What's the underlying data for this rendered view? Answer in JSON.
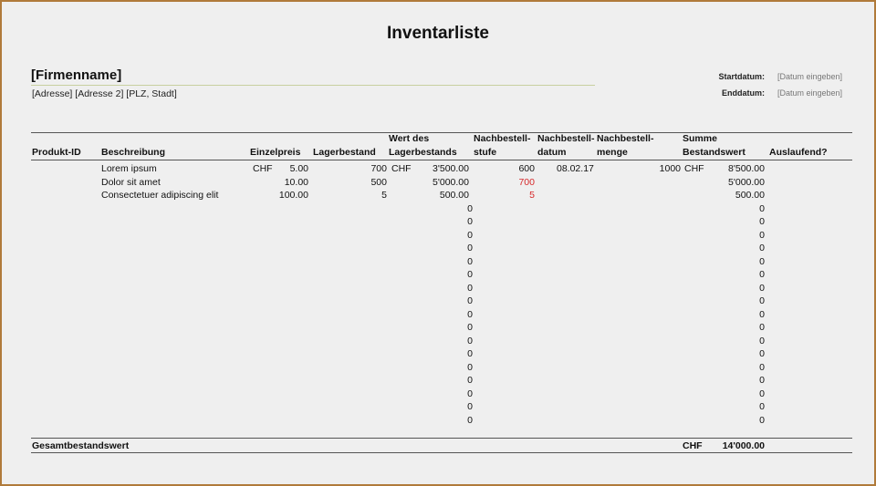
{
  "title": "Inventarliste",
  "company": {
    "name": "[Firmenname]",
    "address": "[Adresse] [Adresse 2] [PLZ, Stadt]"
  },
  "dates": {
    "start_label": "Startdatum:",
    "start_value": "[Datum eingeben]",
    "end_label": "Enddatum:",
    "end_value": "[Datum eingeben]"
  },
  "table": {
    "headers": {
      "product_id": "Produkt-ID",
      "description": "Beschreibung",
      "unit_price": "Einzelpreis",
      "stock": "Lagerbestand",
      "stock_value": "Wert des\nLagerbestands",
      "reorder_level": "Nachbestell-\nstufe",
      "reorder_date": "Nachbestell-\ndatum",
      "reorder_qty": "Nachbestell-\nmenge",
      "total_stock_value": "Summe\nBestandswert",
      "discontinued": "Auslaufend?"
    },
    "rows": [
      {
        "product_id": "",
        "description": "Lorem ipsum",
        "price_currency": "CHF",
        "price": "5.00",
        "stock": "700",
        "value_currency": "CHF",
        "value": "3'500.00",
        "reorder_level": "600",
        "reorder_level_highlight": false,
        "reorder_date": "08.02.17",
        "reorder_qty": "1000",
        "total_currency": "CHF",
        "total": "8'500.00",
        "discontinued": ""
      },
      {
        "product_id": "",
        "description": "Dolor sit amet",
        "price_currency": "",
        "price": "10.00",
        "stock": "500",
        "value_currency": "",
        "value": "5'000.00",
        "reorder_level": "700",
        "reorder_level_highlight": true,
        "reorder_date": "",
        "reorder_qty": "",
        "total_currency": "",
        "total": "5'000.00",
        "discontinued": ""
      },
      {
        "product_id": "",
        "description": "Consectetuer adipiscing elit",
        "price_currency": "",
        "price": "100.00",
        "stock": "5",
        "value_currency": "",
        "value": "500.00",
        "reorder_level": "5",
        "reorder_level_highlight": true,
        "reorder_date": "",
        "reorder_qty": "",
        "total_currency": "",
        "total": "500.00",
        "discontinued": ""
      }
    ],
    "empty_rows": [
      {
        "value": "0",
        "total": "0"
      },
      {
        "value": "0",
        "total": "0"
      },
      {
        "value": "0",
        "total": "0"
      },
      {
        "value": "0",
        "total": "0"
      },
      {
        "value": "0",
        "total": "0"
      },
      {
        "value": "0",
        "total": "0"
      },
      {
        "value": "0",
        "total": "0"
      },
      {
        "value": "0",
        "total": "0"
      },
      {
        "value": "0",
        "total": "0"
      },
      {
        "value": "0",
        "total": "0"
      },
      {
        "value": "0",
        "total": "0"
      },
      {
        "value": "0",
        "total": "0"
      },
      {
        "value": "0",
        "total": "0"
      },
      {
        "value": "0",
        "total": "0"
      },
      {
        "value": "0",
        "total": "0"
      },
      {
        "value": "0",
        "total": "0"
      },
      {
        "value": "0",
        "total": "0"
      }
    ],
    "footer": {
      "label": "Gesamtbestandswert",
      "currency": "CHF",
      "total": "14'000.00"
    }
  },
  "colors": {
    "frame_border": "#b07a3a",
    "background": "#efefef",
    "highlight_red": "#d6282a"
  }
}
